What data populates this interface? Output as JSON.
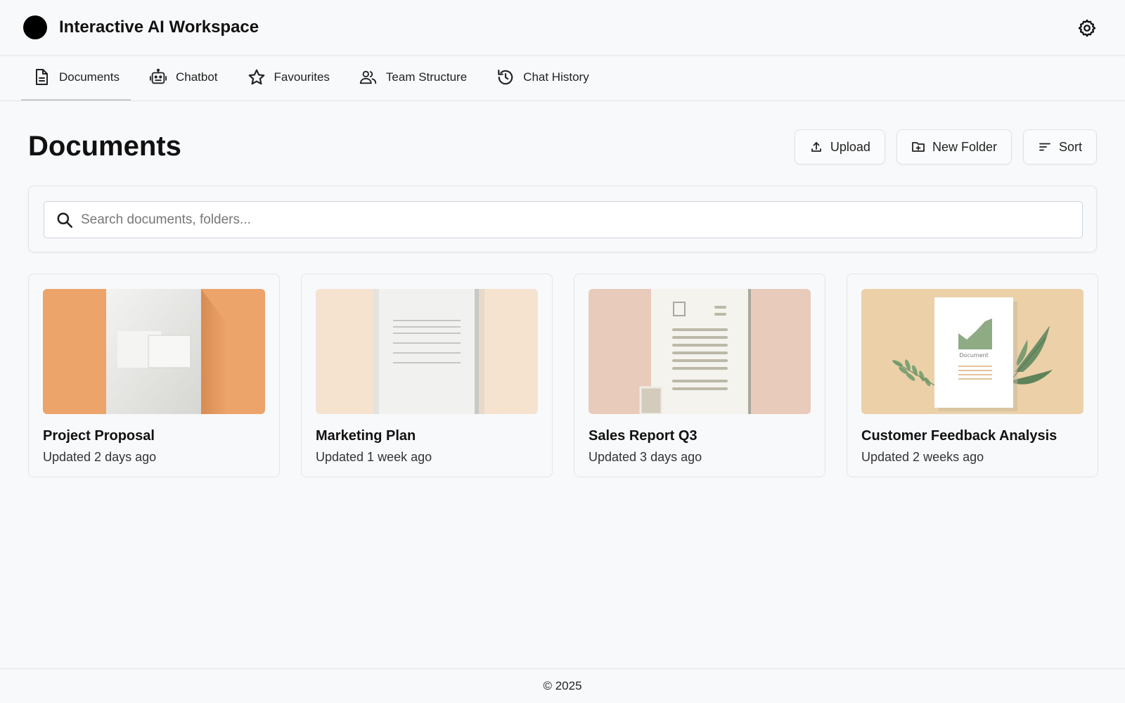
{
  "header": {
    "app_title": "Interactive AI Workspace",
    "logo_icon": "circle-logo",
    "settings_icon": "gear-icon"
  },
  "tabs": [
    {
      "label": "Documents",
      "icon": "document-icon",
      "active": true
    },
    {
      "label": "Chatbot",
      "icon": "robot-icon",
      "active": false
    },
    {
      "label": "Favourites",
      "icon": "star-icon",
      "active": false
    },
    {
      "label": "Team Structure",
      "icon": "users-icon",
      "active": false
    },
    {
      "label": "Chat History",
      "icon": "history-icon",
      "active": false
    }
  ],
  "main": {
    "page_title": "Documents",
    "actions": [
      {
        "label": "Upload",
        "icon": "upload-icon"
      },
      {
        "label": "New Folder",
        "icon": "folder-plus-icon"
      },
      {
        "label": "Sort",
        "icon": "sort-icon"
      }
    ],
    "search": {
      "value": "",
      "placeholder": "Search documents, folders..."
    },
    "documents": [
      {
        "title": "Project Proposal",
        "updated": "Updated 2 days ago",
        "thumb_color": "#eca46a"
      },
      {
        "title": "Marketing Plan",
        "updated": "Updated 1 week ago",
        "thumb_color": "#f5e3d0"
      },
      {
        "title": "Sales Report Q3",
        "updated": "Updated 3 days ago",
        "thumb_color": "#e9cbbb"
      },
      {
        "title": "Customer Feedback Analysis",
        "updated": "Updated 2 weeks ago",
        "thumb_color": "#ebd0a8",
        "thumb_text": "Document"
      }
    ]
  },
  "footer": {
    "copyright": "© 2025"
  }
}
